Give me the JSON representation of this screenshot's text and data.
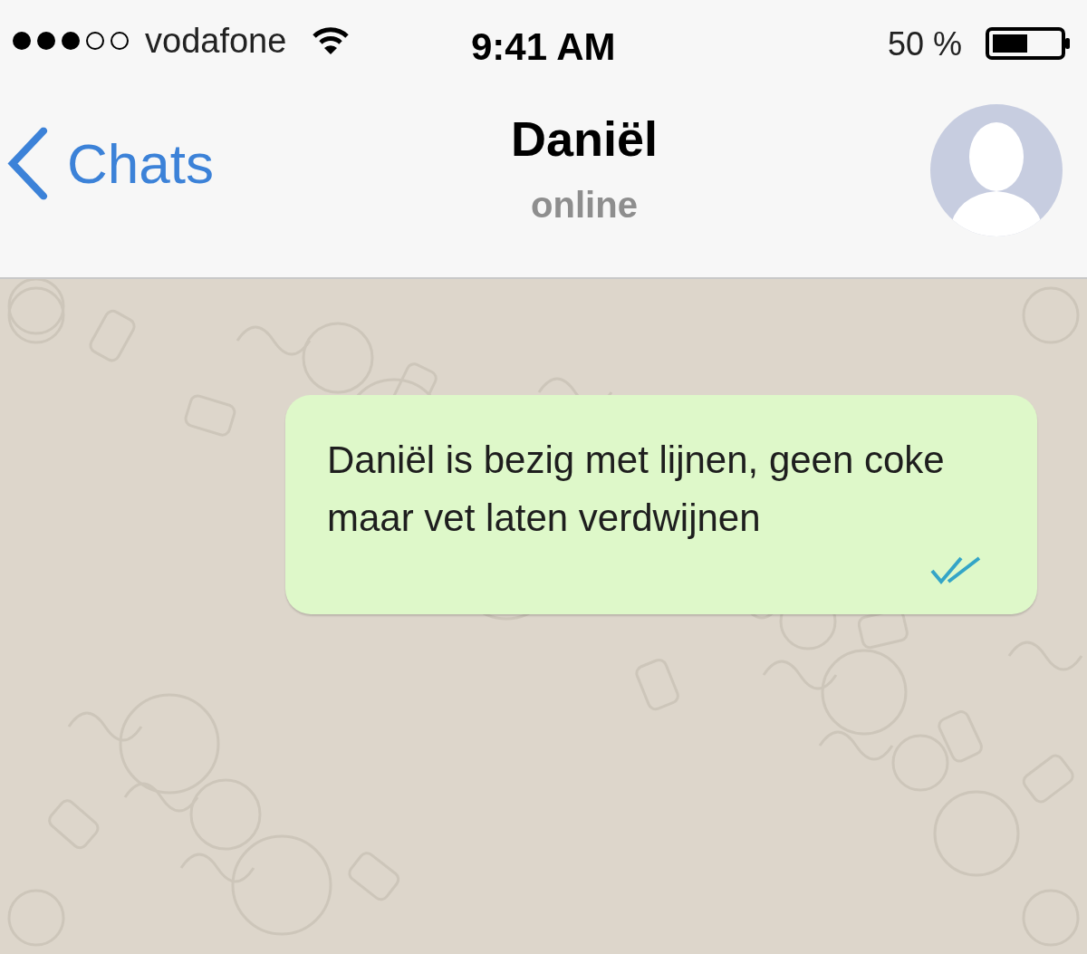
{
  "status_bar": {
    "carrier": "vodafone",
    "time": "9:41 AM",
    "battery": "50 %"
  },
  "header": {
    "back": "Chats",
    "title": "Daniël",
    "subtitle": "online"
  },
  "messages": [
    {
      "text": "Daniël is bezig met lijnen, geen coke maar vet laten verdwijnen",
      "outgoing": true,
      "read": true
    }
  ]
}
